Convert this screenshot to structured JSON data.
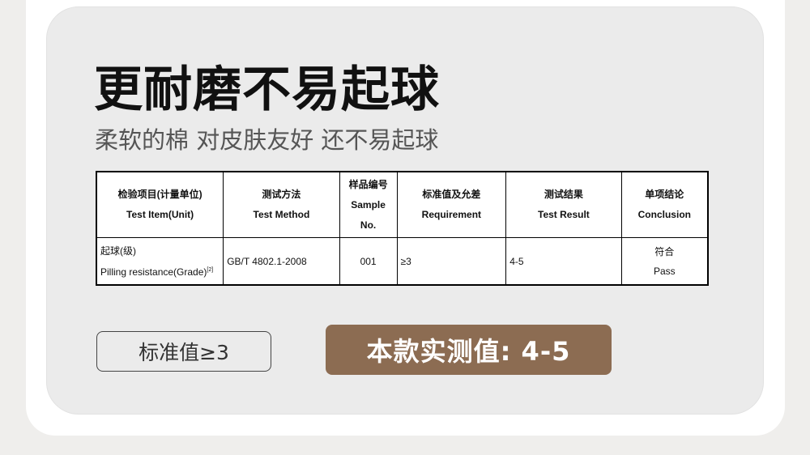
{
  "header": {
    "title": "更耐磨不易起球",
    "subtitle": "柔软的棉 对皮肤友好 还不易起球"
  },
  "table": {
    "headers": [
      {
        "cn": "检验项目(计量单位)",
        "en": "Test Item(Unit)"
      },
      {
        "cn": "测试方法",
        "en": "Test Method"
      },
      {
        "cn": "样品编号",
        "en1": "Sample",
        "en2": "No."
      },
      {
        "cn": "标准值及允差",
        "en": "Requirement"
      },
      {
        "cn": "测试结果",
        "en": "Test Result"
      },
      {
        "cn": "单项结论",
        "en": "Conclusion"
      }
    ],
    "row": {
      "item_cn": "起球(级)",
      "item_en": "Pilling resistance(Grade)",
      "item_note": "[2]",
      "method": "GB/T 4802.1-2008",
      "sample_no": "001",
      "requirement": "≥3",
      "result": "4-5",
      "conclusion_cn": "符合",
      "conclusion_en": "Pass"
    }
  },
  "badges": {
    "standard": "标准值≥3",
    "measured": "本款实测值: 4-5"
  },
  "colors": {
    "accent_brown": "#8c6c52",
    "panel_gray": "#ebebeb"
  }
}
